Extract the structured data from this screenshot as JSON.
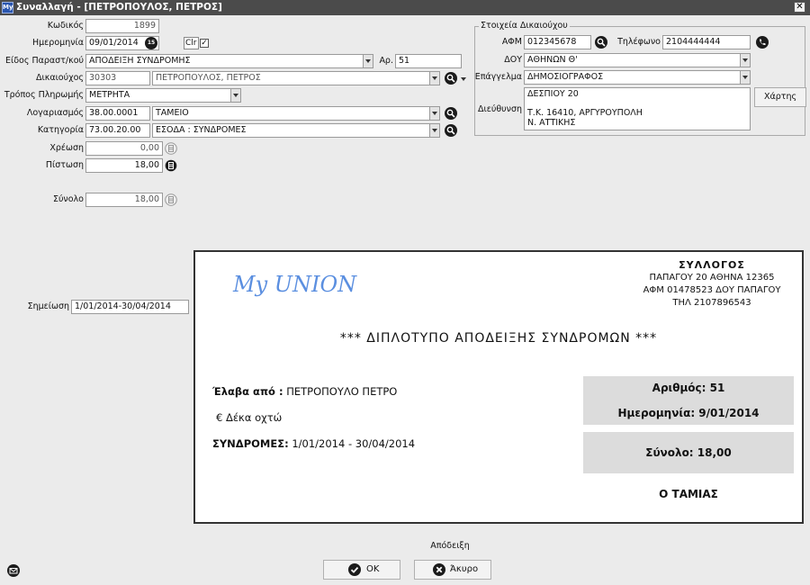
{
  "window": {
    "app_icon": "My",
    "title": "Συναλλαγή - [ΠΕΤΡΟΠΟΥΛΟΣ, ΠΕΤΡΟΣ]",
    "close_label": "✕"
  },
  "form": {
    "code_label": "Κωδικός",
    "code_value": "1899",
    "date_label": "Ημερομηνία",
    "date_value": "09/01/2014",
    "calendar_icon_text": "15",
    "clr_label": "Clr",
    "clr_checked": "✓",
    "doctype_label": "Είδος Παραστ/κού",
    "doctype_value": "ΑΠΟΔΕΙΞΗ ΣΥΝΔΡΟΜΗΣ",
    "number_label": "Αρ.",
    "number_value": "51",
    "beneficiary_label": "Δικαιούχος",
    "beneficiary_code": "30303",
    "beneficiary_name": "ΠΕΤΡΟΠΟΥΛΟΣ, ΠΕΤΡΟΣ",
    "payment_label": "Τρόπος Πληρωμής",
    "payment_value": "ΜΕΤΡΗΤΑ",
    "account_label": "Λογαριασμός",
    "account_code": "38.00.0001",
    "account_name": "ΤΑΜΕΙΟ",
    "category_label": "Κατηγορία",
    "category_code": "73.00.20.00",
    "category_name": "ΕΣΟΔΑ : ΣΥΝΔΡΟΜΕΣ",
    "debit_label": "Χρέωση",
    "debit_value": "0,00",
    "credit_label": "Πίστωση",
    "credit_value": "18,00",
    "total_label": "Σύνολο",
    "total_value": "18,00",
    "note_label": "Σημείωση",
    "note_value": "1/01/2014-30/04/2014"
  },
  "beneficiary_details": {
    "legend": "Στοιχεία Δικαιούχου",
    "afm_label": "ΑΦΜ",
    "afm_value": "012345678",
    "phone_label": "Τηλέφωνο",
    "phone_value": "2104444444",
    "doy_label": "ΔΟΥ",
    "doy_value": "ΑΘΗΝΩΝ Θ'",
    "profession_label": "Επάγγελμα",
    "profession_value": "ΔΗΜΟΣΙΟΓΡΑΦΟΣ",
    "address_label": "Διεύθυνση",
    "address_lines": [
      "ΔΕΣΠΙΟΥ 20",
      "",
      "Τ.Κ. 16410, ΑΡΓΥΡΟΥΠΟΛΗ",
      "Ν. ΑΤΤΙΚΗΣ"
    ],
    "map_button": "Χάρτης"
  },
  "receipt": {
    "logo": "My UNION",
    "org_name": "ΣΥΛΛΟΓΟΣ",
    "org_address": "ΠΑΠΑΓΟΥ 20 ΑΘΗΝΑ 12365",
    "org_afm": "ΑΦΜ 01478523 ΔΟΥ ΠΑΠΑΓΟΥ",
    "org_phone": "ΤΗΛ 2107896543",
    "heading": "*** ΔΙΠΛΟΤΥΠΟ ΑΠΟΔΕΙΞΗΣ ΣΥΝΔΡΟΜΩΝ ***",
    "received_label": "Έλαβα από :",
    "received_value": "ΠΕΤΡΟΠΟΥΛΟ ΠΕΤΡΟ",
    "amount_words": "€ Δέκα οχτώ",
    "subs_label": "ΣΥΝΔΡΟΜΕΣ:",
    "subs_value": "1/01/2014 - 30/04/2014",
    "number_text": "Αριθμός: 51",
    "date_text": "Ημερομηνία: 9/01/2014",
    "total_text": "Σύνολο: 18,00",
    "cashier": "Ο ΤΑΜΙΑΣ"
  },
  "footer": {
    "receipt_label": "Απόδειξη",
    "ok_label": "OK",
    "cancel_label": "Άκυρο"
  }
}
